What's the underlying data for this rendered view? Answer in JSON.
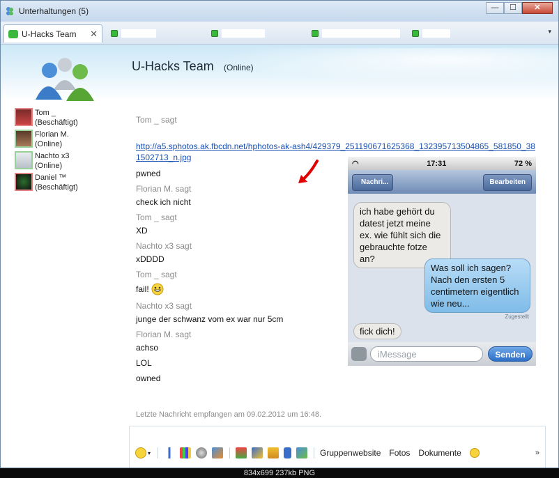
{
  "window": {
    "title": "Unterhaltungen (5)"
  },
  "tabs": {
    "active": {
      "label": "U-Hacks Team",
      "close": "✕"
    },
    "hidden_count": 4,
    "overflow": "▾"
  },
  "header": {
    "contact": "U-Hacks Team",
    "status": "(Online)"
  },
  "participants": [
    {
      "name": "Tom _",
      "status": "(Beschäftigt)",
      "color": "#e38383"
    },
    {
      "name": "Florian M.",
      "status": "(Online)",
      "color": "#9ad19a"
    },
    {
      "name": "Nachto x3",
      "status": "(Online)",
      "color": "#9ad19a"
    },
    {
      "name": "Daniel ™",
      "status": "(Beschäftigt)",
      "color": "#e38383"
    }
  ],
  "messages": [
    {
      "sender": "Tom _ sagt",
      "lines": [
        "http://a5.sphotos.ak.fbcdn.net/hphotos-ak-ash4/429379_251190671625368_132395713504865_581850_381502713_n.jpg",
        "pwned"
      ]
    },
    {
      "sender": "Florian M. sagt",
      "lines": [
        "check ich nicht"
      ]
    },
    {
      "sender": "Tom _ sagt",
      "lines": [
        "XD"
      ]
    },
    {
      "sender": "Nachto x3 sagt",
      "lines": [
        "xDDDD"
      ]
    },
    {
      "sender": "Tom _ sagt",
      "lines": [
        "fail!"
      ]
    },
    {
      "sender": "Nachto x3 sagt",
      "lines": [
        "junge der schwanz vom ex war nur 5cm"
      ]
    },
    {
      "sender": "Florian M. sagt",
      "lines": [
        "achso",
        "LOL",
        "owned"
      ]
    }
  ],
  "footer_note": "Letzte Nachricht empfangen am 09.02.2012 um 16:48.",
  "phone": {
    "time": "17:31",
    "battery": "72 %",
    "back": "Nachri...",
    "edit": "Bearbeiten",
    "bubble_in_1": "ich habe gehört du datest jetzt meine ex. wie fühlt sich die gebrauchte fotze an?",
    "bubble_out": "Was soll ich sagen? Nach den ersten 5 centimetern eigentlich wie neu...",
    "delivered": "Zugestellt",
    "bubble_in_2": "fick dich!",
    "input_placeholder": "iMessage",
    "send": "Senden"
  },
  "toolbar": {
    "links": [
      "Gruppenwebsite",
      "Fotos",
      "Dokumente"
    ],
    "more": "»"
  },
  "image_info": "834x699  237kb  PNG",
  "colors": {
    "accent": "#1a4fb2",
    "online": "#3cb83c",
    "busy": "#e38383"
  }
}
